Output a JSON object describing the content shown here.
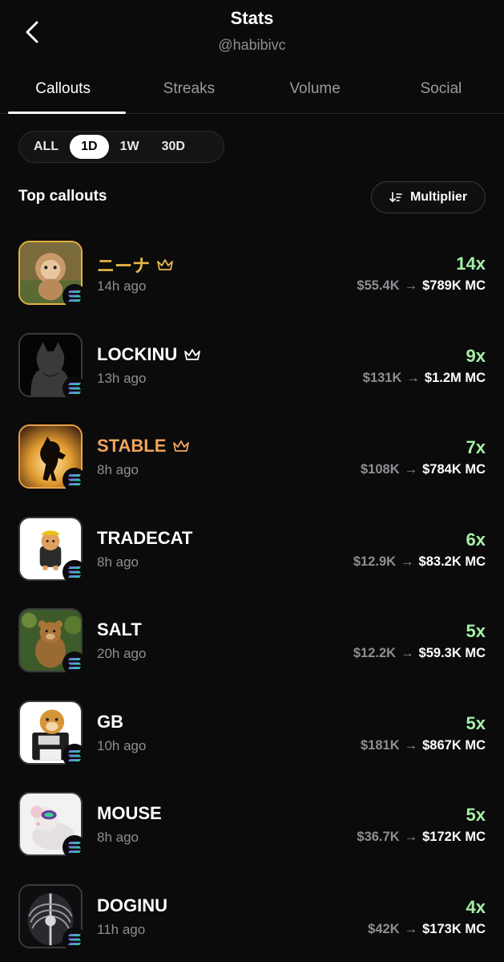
{
  "header": {
    "title": "Stats",
    "handle": "@habibivc"
  },
  "tabs": [
    {
      "label": "Callouts",
      "active": true
    },
    {
      "label": "Streaks",
      "active": false
    },
    {
      "label": "Volume",
      "active": false
    },
    {
      "label": "Social",
      "active": false
    }
  ],
  "filters": [
    {
      "label": "ALL",
      "active": false
    },
    {
      "label": "1D",
      "active": true
    },
    {
      "label": "1W",
      "active": false
    },
    {
      "label": "30D",
      "active": false
    }
  ],
  "section": {
    "title": "Top callouts",
    "sort_label": "Multiplier"
  },
  "colors": {
    "multiplier": "#a6f0a6",
    "gold": "#e8b84a",
    "orange": "#f0a45a",
    "muted": "#8e8e93"
  },
  "callouts": [
    {
      "name": "ニーナ",
      "time": "14h ago",
      "multiplier": "14x",
      "from_mc": "$55.4K",
      "to_mc": "$789K MC",
      "style": "gold",
      "crown": true,
      "image": "monkey"
    },
    {
      "name": "LOCKINU",
      "time": "13h ago",
      "multiplier": "9x",
      "from_mc": "$131K",
      "to_mc": "$1.2M MC",
      "style": "plain",
      "crown": true,
      "image": "dog-back"
    },
    {
      "name": "STABLE",
      "time": "8h ago",
      "multiplier": "7x",
      "from_mc": "$108K",
      "to_mc": "$784K MC",
      "style": "orange",
      "crown": true,
      "image": "horse"
    },
    {
      "name": "TRADECAT",
      "time": "8h ago",
      "multiplier": "6x",
      "from_mc": "$12.9K",
      "to_mc": "$83.2K MC",
      "style": "plain",
      "crown": false,
      "image": "cat"
    },
    {
      "name": "SALT",
      "time": "20h ago",
      "multiplier": "5x",
      "from_mc": "$12.2K",
      "to_mc": "$59.3K MC",
      "style": "plain",
      "crown": false,
      "image": "bear"
    },
    {
      "name": "GB",
      "time": "10h ago",
      "multiplier": "5x",
      "from_mc": "$181K",
      "to_mc": "$867K MC",
      "style": "plain",
      "crown": false,
      "image": "doge-floppy"
    },
    {
      "name": "MOUSE",
      "time": "8h ago",
      "multiplier": "5x",
      "from_mc": "$36.7K",
      "to_mc": "$172K MC",
      "style": "plain",
      "crown": false,
      "image": "mouse"
    },
    {
      "name": "DOGINU",
      "time": "11h ago",
      "multiplier": "4x",
      "from_mc": "$42K",
      "to_mc": "$173K MC",
      "style": "plain",
      "crown": false,
      "image": "xray"
    }
  ]
}
